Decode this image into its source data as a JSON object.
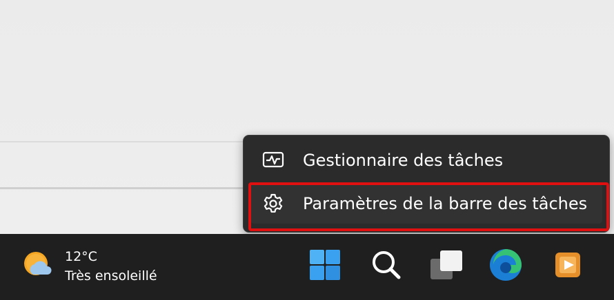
{
  "context_menu": {
    "items": [
      {
        "label": "Gestionnaire des tâches",
        "icon": "task-manager-icon"
      },
      {
        "label": "Paramètres de la barre des tâches",
        "icon": "gear-icon"
      }
    ],
    "highlight_color": "#e01010"
  },
  "taskbar": {
    "weather": {
      "temperature": "12°C",
      "description": "Très ensoleillé",
      "icon": "sun-cloud-icon"
    },
    "apps": [
      {
        "name": "start-icon"
      },
      {
        "name": "search-icon"
      },
      {
        "name": "task-view-icon"
      },
      {
        "name": "edge-icon"
      },
      {
        "name": "media-player-icon"
      }
    ]
  },
  "colors": {
    "menu_background": "#2b2b2b",
    "taskbar_background": "#1f1f1f",
    "start_blue": "#3aa0f0"
  }
}
